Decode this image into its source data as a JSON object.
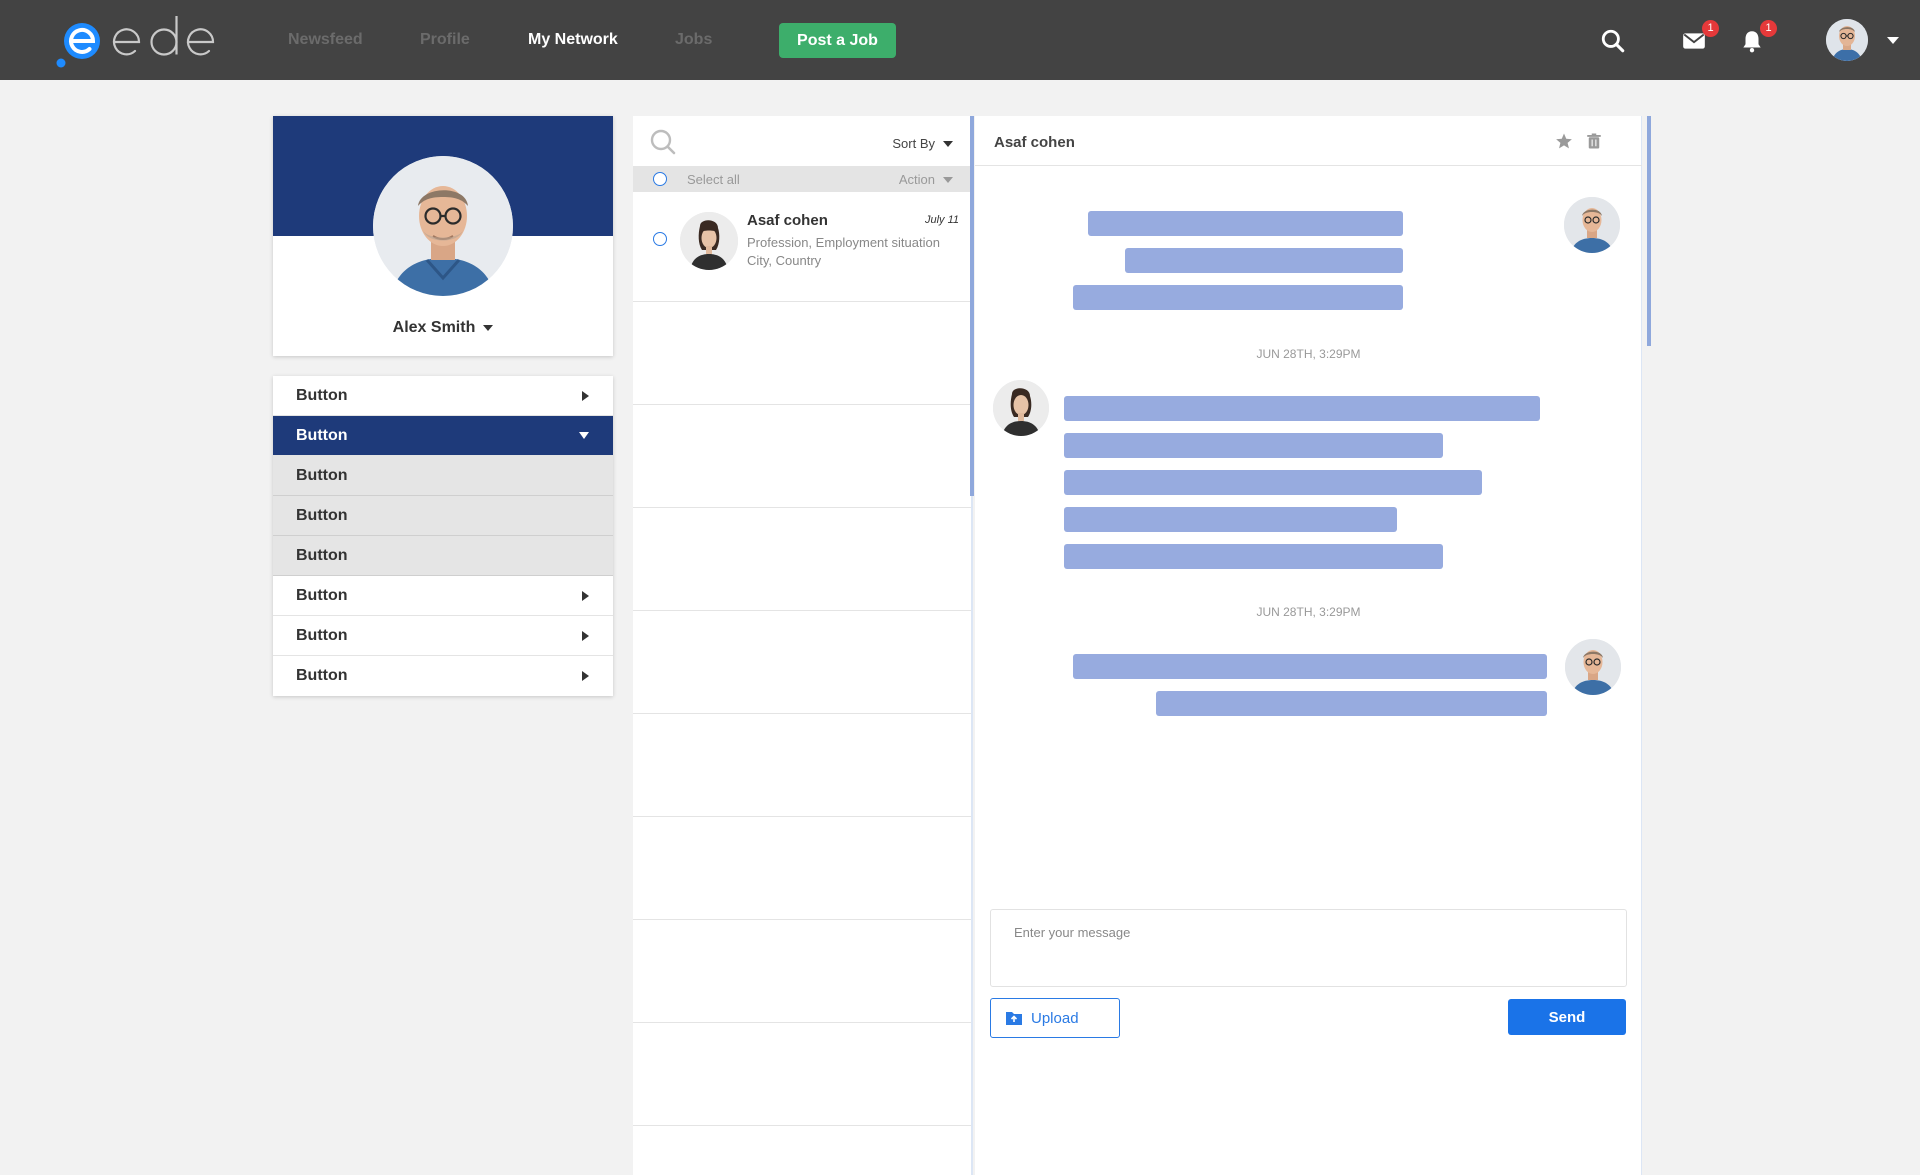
{
  "app": {
    "logo_text": "edea",
    "colors": {
      "topbar": "#434343",
      "brand_blue": "#1e3a7a",
      "accent": "#1a73e8",
      "green": "#3dae6b",
      "bubble": "#97abdf"
    }
  },
  "nav": {
    "links": [
      {
        "label": "Newsfeed",
        "active": false
      },
      {
        "label": "Profile",
        "active": false
      },
      {
        "label": "My Network",
        "active": true
      },
      {
        "label": "Jobs",
        "active": false
      }
    ],
    "post_job_label": "Post a Job",
    "icons": {
      "search": "search-icon",
      "mail": "mail-icon",
      "bell": "bell-icon"
    },
    "mail_badge": "1",
    "bell_badge": "1"
  },
  "profile": {
    "name": "Alex Smith"
  },
  "menu": {
    "items": [
      {
        "label": "Button",
        "state": "collapsed"
      },
      {
        "label": "Button",
        "state": "expanded"
      },
      {
        "label": "Button",
        "state": "sub"
      },
      {
        "label": "Button",
        "state": "sub"
      },
      {
        "label": "Button",
        "state": "sub"
      },
      {
        "label": "Button",
        "state": "collapsed"
      },
      {
        "label": "Button",
        "state": "collapsed"
      },
      {
        "label": "Button",
        "state": "collapsed"
      }
    ]
  },
  "messages": {
    "sort_label": "Sort By",
    "select_all_label": "Select all",
    "action_label": "Action",
    "conversations": [
      {
        "name": "Asaf cohen",
        "date": "July 11",
        "line1": "Profession, Employment situation",
        "line2": "City, Country"
      }
    ]
  },
  "chat": {
    "title": "Asaf cohen",
    "timestamps": [
      "JUN 28TH, 3:29PM",
      "JUN 28TH, 3:29PM"
    ],
    "input_placeholder": "Enter your message",
    "upload_label": "Upload",
    "send_label": "Send"
  }
}
